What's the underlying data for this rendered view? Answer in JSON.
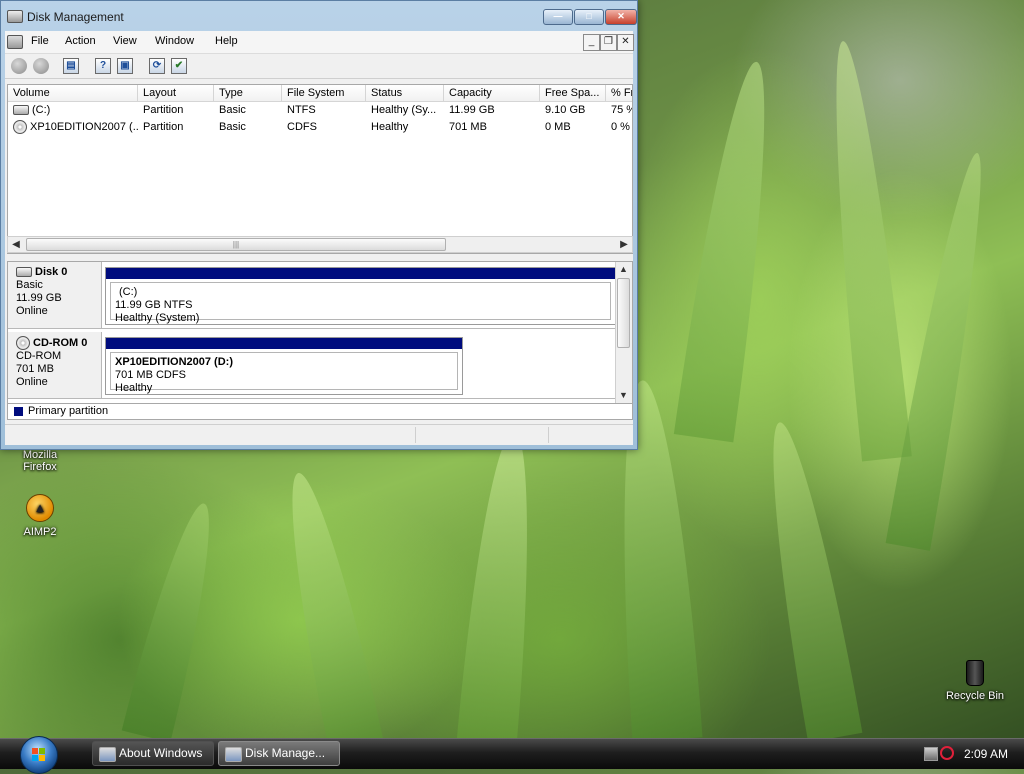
{
  "window": {
    "title": "Disk Management",
    "controls": [
      "minimize-icon",
      "maximize-icon",
      "close-icon"
    ]
  },
  "menu": {
    "items": [
      "File",
      "Action",
      "View",
      "Window",
      "Help"
    ]
  },
  "volume_list": {
    "columns": [
      "Volume",
      "Layout",
      "Type",
      "File System",
      "Status",
      "Capacity",
      "Free Spa...",
      "% Fr"
    ],
    "rows": [
      {
        "volume": "(C:)",
        "layout": "Partition",
        "type": "Basic",
        "fs": "NTFS",
        "status": "Healthy (Sy...",
        "capacity": "11.99 GB",
        "free": "9.10 GB",
        "pct": "75 %"
      },
      {
        "volume": "XP10EDITION2007 (...",
        "layout": "Partition",
        "type": "Basic",
        "fs": "CDFS",
        "status": "Healthy",
        "capacity": "701 MB",
        "free": "0 MB",
        "pct": "0 %"
      }
    ]
  },
  "disks": [
    {
      "name": "Disk 0",
      "kind": "Basic",
      "size": "11.99 GB",
      "state": "Online",
      "partition": {
        "label": "(C:)",
        "detail": "11.99 GB NTFS",
        "health": "Healthy (System)"
      }
    },
    {
      "name": "CD-ROM 0",
      "kind": "CD-ROM",
      "size": "701 MB",
      "state": "Online",
      "partition": {
        "label": "XP10EDITION2007  (D:)",
        "detail": "701 MB CDFS",
        "health": "Healthy"
      }
    }
  ],
  "legend": {
    "primary_label": "Primary partition",
    "primary_color": "#000c7e"
  },
  "desktop": {
    "icons": [
      {
        "label": "Mozilla\nFirefox"
      },
      {
        "label": "AIMP2"
      },
      {
        "label": "Recycle Bin"
      }
    ]
  },
  "taskbar": {
    "buttons": [
      {
        "label": "About Windows",
        "active": false
      },
      {
        "label": "Disk Manage...",
        "active": true
      }
    ],
    "clock": "2:09 AM"
  }
}
